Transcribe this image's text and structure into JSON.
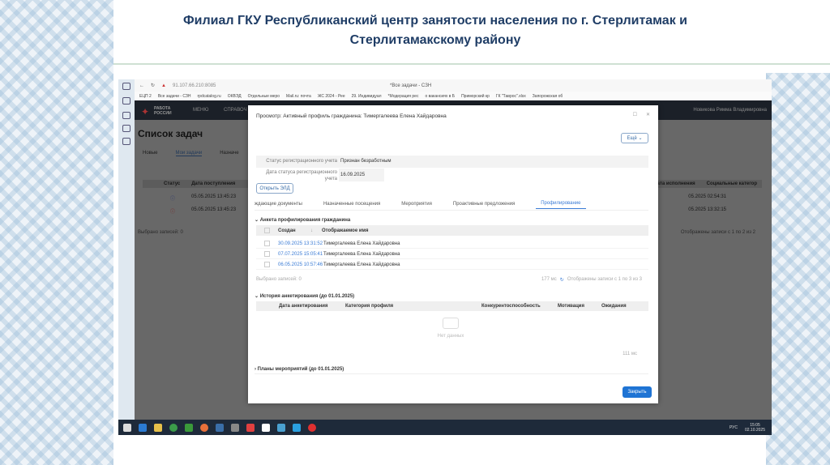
{
  "slide": {
    "title": "Филиал ГКУ Республиканский центр занятости населения по г. Стерлитамак и Стерлитамакскому району"
  },
  "browser": {
    "url": "91.107.66.210:8085",
    "tab_title": "*Все задачи - СЗН",
    "bookmarks": [
      "ЕЦП 2",
      "Все задачи - СЗН",
      "rpdcatalog.ru",
      "ОКВЭД",
      "Отдельные мерo",
      "Mail.ru: почта",
      "ЖС 2024 - Рее",
      "29. Индивидуал",
      "*Модерация рес",
      "о вакансиях в Б",
      "Приморский кр",
      "ГК \"Тавроc\".xlsx",
      "Запорожская об"
    ]
  },
  "app": {
    "logo": "РАБОТА РОССИИ",
    "menu": [
      "МЕНЮ",
      "СПРАВОЧ"
    ],
    "user": "Новикова Римма Владимировна",
    "page_title": "Список задач",
    "tabs": [
      "Новые",
      "Мои задачи",
      "Назначе"
    ],
    "columns": [
      "Статус",
      "Дата поступления",
      "Дата исполнения",
      "Социальные категор"
    ],
    "rows": [
      {
        "received": "05.05.2025 13:45:23",
        "done": "05.2025 02:54:31"
      },
      {
        "received": "05.05.2025 13:45:23",
        "done": "05.2025 13:32:15"
      }
    ],
    "footer": "Выбрано записей: 0",
    "pager": "Отображены записи с 1 по 2 из 2"
  },
  "modal": {
    "title": "Просмотр: Активный профиль гражданина: Тимергалеева Елена Хайдаровна",
    "more_button": "Ещё",
    "fields": [
      {
        "label": "Статус регистрационного учета",
        "value": "Признан безработным"
      },
      {
        "label": "Дата статуса регистрационного учета",
        "value": "16.09.2025"
      }
    ],
    "open_button": "Открыть ЭЛД",
    "tabs": [
      "ждающие документы",
      "Назначенные посещения",
      "Мероприятия",
      "Проактивные предложения",
      "Профилирование"
    ],
    "active_tab": 4,
    "section1": {
      "title": "Анкета профилирования гражданина",
      "columns": [
        "Создан",
        "Отображаемое имя"
      ],
      "rows": [
        {
          "created": "30.09.2025 13:31:52",
          "name": "Тимергалеева Елена Хайдаровна"
        },
        {
          "created": "07.07.2025 15:05:41",
          "name": "Тимергалеева Елена Хайдаровна"
        },
        {
          "created": "06.05.2025 10:57:46",
          "name": "Тимергалеева Елена Хайдаровна"
        }
      ],
      "selected": "Выбрано записей: 0",
      "timing": "177 мс",
      "pager": "Отображены записи с 1 по 3 из 3"
    },
    "section2": {
      "title": "История анкетирования (до 01.01.2025)",
      "columns": [
        "Дата анкетирования",
        "Категория профиля",
        "Конкурентоспособность",
        "Мотивация",
        "Ожидания"
      ],
      "empty": "Нет данных",
      "timing": "111 мс"
    },
    "section3": {
      "title": "Планы мероприятий (до 01.01.2025)"
    },
    "close_button": "Закрыть"
  },
  "taskbar": {
    "lang": "РУС",
    "time": "15:05",
    "date": "02.10.2025"
  }
}
